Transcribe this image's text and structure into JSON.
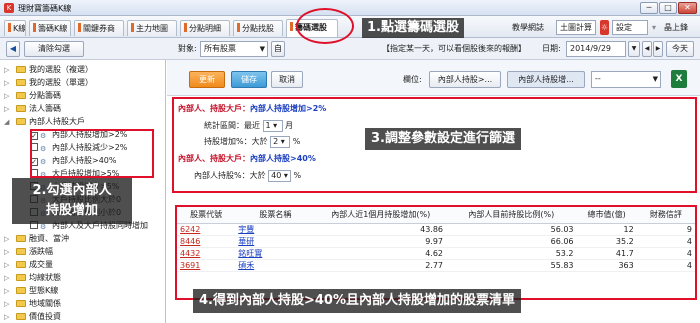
{
  "window": {
    "app_icon": "K",
    "title": "理財寶籌碼K線",
    "min": "─",
    "max": "□",
    "close": "✕"
  },
  "tabs": [
    {
      "label": "K線",
      "w": 22
    },
    {
      "label": "籌碼K線",
      "w": 42
    },
    {
      "label": "關鍵券商",
      "w": 50
    },
    {
      "label": "主力地圖",
      "w": 50
    },
    {
      "label": "分點明細",
      "w": 50
    },
    {
      "label": "分點找股",
      "w": 50
    },
    {
      "label": "籌碼選股",
      "w": 52
    }
  ],
  "right_tabs": {
    "teaching": "教學網誌",
    "single": "土圖計算",
    "settings": "設定",
    "user": "晶上鋒"
  },
  "toolbar": {
    "clear_label": "清除勾選",
    "target_label": "對象:",
    "target_value": "所有股票",
    "self_label": "自",
    "hint_text": "【指定某一天，可以看個股後來的報酬】",
    "date_label": "日期:",
    "date_value": "2014/9/29",
    "today_label": "今天"
  },
  "tree": [
    {
      "label": "我的選股（複選）",
      "kind": "folder",
      "indent": 1
    },
    {
      "label": "我的選股（單選）",
      "kind": "folder",
      "indent": 1
    },
    {
      "label": "分點籌碼",
      "kind": "folder",
      "indent": 1
    },
    {
      "label": "法人籌碼",
      "kind": "folder",
      "indent": 1
    },
    {
      "label": "內部人持股大戶",
      "kind": "folder-open",
      "indent": 1
    },
    {
      "label": "內部人持股增加>2%",
      "kind": "check",
      "checked": true,
      "indent": 2
    },
    {
      "label": "內部人持股減少>2%",
      "kind": "check",
      "checked": false,
      "indent": 2
    },
    {
      "label": "內部人持股>40%",
      "kind": "check",
      "checked": true,
      "indent": 2
    },
    {
      "label": "大戶持股增加>5%",
      "kind": "check",
      "checked": false,
      "indent": 2
    },
    {
      "label": "大戶持股減少>5%",
      "kind": "check",
      "checked": false,
      "indent": 2
    },
    {
      "label": "大戶持股比例大於0",
      "kind": "check",
      "checked": false,
      "indent": 2
    },
    {
      "label": "大戶持股比例小於0",
      "kind": "check",
      "checked": false,
      "indent": 2
    },
    {
      "label": "內部人及大戶持股同時增加",
      "kind": "check",
      "checked": false,
      "indent": 2
    },
    {
      "label": "融資、當沖",
      "kind": "folder",
      "indent": 1
    },
    {
      "label": "漲跌幅",
      "kind": "folder",
      "indent": 1
    },
    {
      "label": "成交量",
      "kind": "folder",
      "indent": 1
    },
    {
      "label": "均線狀態",
      "kind": "folder",
      "indent": 1
    },
    {
      "label": "型態K線",
      "kind": "folder",
      "indent": 1
    },
    {
      "label": "地域關係",
      "kind": "folder",
      "indent": 1
    },
    {
      "label": "價值投資",
      "kind": "folder",
      "indent": 1
    }
  ],
  "main_toolbar": {
    "update": "更新",
    "save": "儲存",
    "cancel": "取消",
    "column_label": "欄位:",
    "col1": "內部人持股>...",
    "col2": "內部人持股增...",
    "col3": "--"
  },
  "params": {
    "group1_prefix": "內部人、持股大戶：",
    "group1_name": "內部人持股增加>2%",
    "period_label": "統計區間：最近",
    "period_value": "1",
    "period_unit": "月",
    "increase_label": "持股增加%：大於",
    "increase_value": "2",
    "pct": "%",
    "group2_prefix": "內部人、持股大戶：",
    "group2_name": "內部人持股>40%",
    "hold_label": "內部人持股%：大於",
    "hold_value": "40"
  },
  "table": {
    "headers": [
      "股票代號",
      "股票名稱",
      "內部人近1個月持股增加(%)",
      "內部人目前持股比例(%)",
      "總市值(億)",
      "財務信評"
    ],
    "rows": [
      [
        "6242",
        "宇豐",
        "43.86",
        "56.03",
        "12",
        "9"
      ],
      [
        "8446",
        "華研",
        "9.97",
        "66.06",
        "35.2",
        "4"
      ],
      [
        "4432",
        "銘旺實",
        "4.62",
        "53.2",
        "41.7",
        "4"
      ],
      [
        "3691",
        "碩禾",
        "2.77",
        "55.83",
        "363",
        "4"
      ]
    ]
  },
  "callouts": {
    "step1": "1.點選籌碼選股",
    "step2": "2.勾選內部人\n持股增加",
    "step3": "3.調整參數設定進行篩選",
    "step4": "4.得到內部人持股>40%且內部人持股增加的股票清單"
  },
  "colors": {
    "accent_red": "#e0102a",
    "orange": "#f08a1c",
    "blue": "#3d9ad6"
  }
}
